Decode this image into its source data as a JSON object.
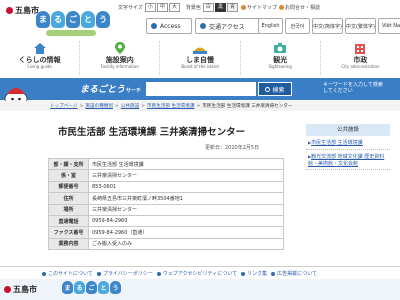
{
  "header": {
    "city_name": "五島市",
    "logo_chars": [
      "ま",
      "る",
      "ご",
      "と",
      "う"
    ],
    "utility": {
      "font_size_label": "文字サイズ",
      "font_sizes": [
        "小",
        "中",
        "大"
      ],
      "bg_color_label": "背景色",
      "bg_colors": [
        "白",
        "黒",
        "青"
      ],
      "sitemap": "サイトマップ",
      "contact": "お問合せ・相談"
    },
    "quick_links": [
      {
        "label": "Access",
        "icon": "pin-icon"
      },
      {
        "label": "交通アクセス",
        "icon": "bus-icon"
      }
    ],
    "languages": [
      "English",
      "한국어",
      "中文(简体字)",
      "中文(繁体字)",
      "Việt Nam"
    ],
    "global_nav": [
      {
        "label": "くらしの情報",
        "sub": "Living guide",
        "icon": "house-icon"
      },
      {
        "label": "施設案内",
        "sub": "Facility information",
        "icon": "map-pin-icon"
      },
      {
        "label": "しま自慢",
        "sub": "Boast of the island",
        "icon": "island-icon"
      },
      {
        "label": "観光",
        "sub": "Sightseeing",
        "icon": "camera-icon"
      },
      {
        "label": "市政",
        "sub": "City administration",
        "icon": "building-icon"
      }
    ]
  },
  "search": {
    "brand": "まるごとう",
    "brand_sub": "サーチ",
    "placeholder": "",
    "button": "検索",
    "hint": "キーワードを入力して検索してください"
  },
  "breadcrumb": {
    "items": [
      "トップページ",
      "施設の種類別",
      "公共施設",
      "市民生活部 生活環境課",
      "市民生活部 生活環境課 三井楽清掃センター"
    ]
  },
  "main": {
    "title": "市民生活部 生活環境課 三井楽清掃センター",
    "updated": "更新日：2020年2月5日",
    "rows": [
      {
        "label": "部・課・支所",
        "value": "市民生活部 生活環境課"
      },
      {
        "label": "係・室",
        "value": "三井楽清掃センター"
      },
      {
        "label": "郵便番号",
        "value": "853-0601"
      },
      {
        "label": "住所",
        "value": "長崎県五島市三井楽町濱ノ畔3504番地1"
      },
      {
        "label": "場所",
        "value": "三井楽清掃センター"
      },
      {
        "label": "直通電話",
        "value": "0959-84-2960"
      },
      {
        "label": "ファクス番号",
        "value": "0959-84-2960（直通）"
      },
      {
        "label": "業務内容",
        "value": "ごみ搬入受入のみ"
      }
    ]
  },
  "sidebar": {
    "heading": "公共施設",
    "items": [
      "市民生活部 生活環境課",
      "観光交流部 地域文化課 歴史資料館・美術館・文化会館"
    ]
  },
  "footer": {
    "links": [
      "このサイトについて",
      "プライバシーポリシー",
      "ウェブアクセシビリティについて",
      "リンク集",
      "広告掲載について"
    ],
    "city_name": "五島市",
    "logo_chars": [
      "ま",
      "る",
      "ご",
      "と",
      "う"
    ]
  },
  "colors": {
    "primary_blue": "#3a7ec6",
    "link_blue": "#2a5cae",
    "accent_red": "#c8102e"
  }
}
